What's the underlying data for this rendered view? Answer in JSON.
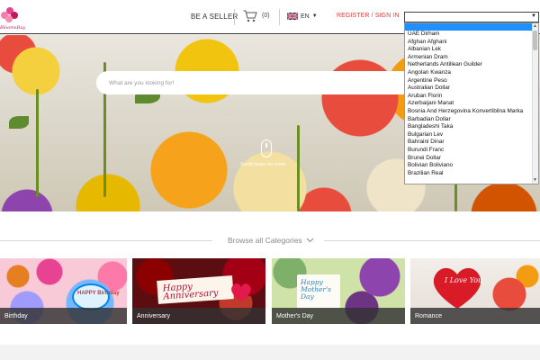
{
  "header": {
    "logo_text": "BloomsBuy",
    "be_seller": "BE A SELLER",
    "cart_count": "(0)",
    "language": "EN",
    "register_signin": "REGISTER / SIGN IN"
  },
  "currency_select": {
    "selected": "",
    "options": [
      "UAE Dirham",
      "Afghan Afghani",
      "Albanian Lek",
      "Armenian Dram",
      "Netherlands Antillean Guilder",
      "Angolan Kwanza",
      "Argentine Peso",
      "Australian Dollar",
      "Aruban Florin",
      "Azerbaijani Manat",
      "Bosnia And Herzegovina Konvertibilna Marka",
      "Barbadian Dollar",
      "Bangladeshi Taka",
      "Bulgarian Lev",
      "Bahraini Dinar",
      "Burundi Franc",
      "Brunei Dollar",
      "Bolivian Boliviano",
      "Brazilian Real"
    ]
  },
  "hero": {
    "search_placeholder": "What are you looking for!",
    "scroll_hint": "Scroll down for more"
  },
  "categories": {
    "label": "Browse all Categories",
    "cards": [
      {
        "name": "Birthday",
        "overlay": "HAPPY Birthday"
      },
      {
        "name": "Anniversary",
        "overlay": "Happy Anniversary"
      },
      {
        "name": "Mother's Day",
        "overlay": "Happy Mother's Day"
      },
      {
        "name": "Romance",
        "overlay": "I Love You"
      }
    ]
  },
  "icons": {
    "cart": "cart-icon",
    "flag": "uk-flag-icon",
    "mouse": "mouse-scroll-icon",
    "chevron": "chevron-down-icon"
  },
  "colors": {
    "accent_red": "#e53935",
    "dropdown_highlight": "#1e90ff"
  }
}
